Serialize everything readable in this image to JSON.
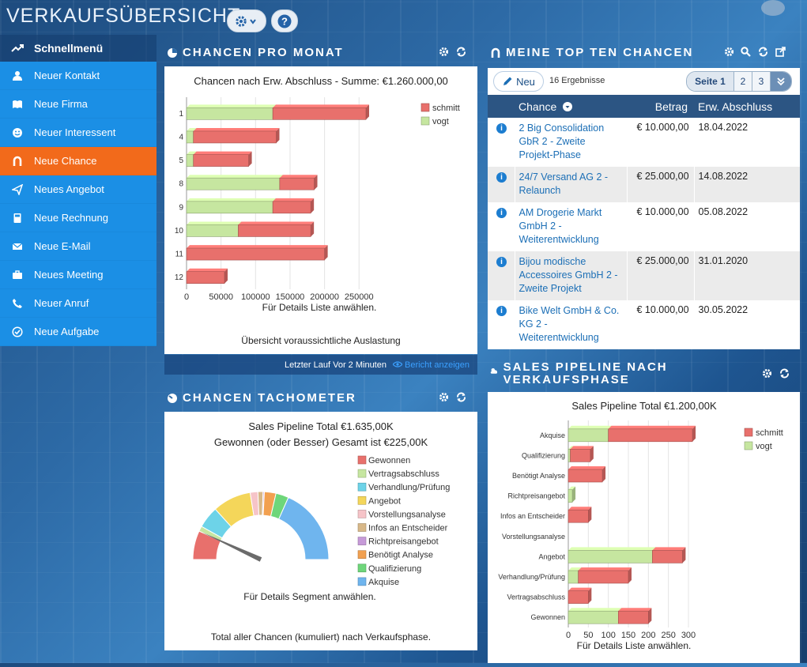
{
  "app": {
    "title": "VERKAUFSÜBERSICHT"
  },
  "sidebar": {
    "header": "Schnellmenü",
    "items": [
      {
        "label": "Neuer Kontakt",
        "icon": "person-icon"
      },
      {
        "label": "Neue Firma",
        "icon": "book-icon"
      },
      {
        "label": "Neuer Interessent",
        "icon": "smiley-icon"
      },
      {
        "label": "Neue Chance",
        "icon": "magnet-icon",
        "active": true
      },
      {
        "label": "Neues Angebot",
        "icon": "paper-plane-icon"
      },
      {
        "label": "Neue Rechnung",
        "icon": "calculator-icon"
      },
      {
        "label": "Neue E-Mail",
        "icon": "envelope-icon"
      },
      {
        "label": "Neues Meeting",
        "icon": "briefcase-icon"
      },
      {
        "label": "Neuer Anruf",
        "icon": "phone-icon"
      },
      {
        "label": "Neue Aufgabe",
        "icon": "check-circle-icon"
      }
    ]
  },
  "panels": {
    "chancen_pro_monat": {
      "title": "CHANCEN PRO MONAT",
      "footer": "Übersicht voraussichtliche Auslastung",
      "last_run": "Letzter Lauf Vor 2 Minuten",
      "report_link": "Bericht anzeigen"
    },
    "top_ten": {
      "title": "MEINE TOP TEN CHANCEN",
      "new_label": "Neu",
      "count": "16 Ergebnisse",
      "pager": {
        "current": "Seite 1",
        "p2": "2",
        "p3": "3"
      },
      "columns": {
        "chance": "Chance",
        "betrag": "Betrag",
        "abschluss": "Erw. Abschluss"
      },
      "rows": [
        {
          "name": "2 Big Consolidation GbR 2 - Zweite Projekt-Phase",
          "betrag": "€ 10.000,00",
          "datum": "18.04.2022"
        },
        {
          "name": "24/7 Versand AG 2 - Relaunch",
          "betrag": "€ 25.000,00",
          "datum": "14.08.2022"
        },
        {
          "name": "AM Drogerie Markt GmbH 2 - Weiterentwicklung",
          "betrag": "€ 10.000,00",
          "datum": "05.08.2022"
        },
        {
          "name": "Bijou modische Accessoires GmbH 2 - Zweite Projekt",
          "betrag": "€ 25.000,00",
          "datum": "31.01.2020"
        },
        {
          "name": "Bike Welt GmbH & Co. KG 2 - Weiterentwicklung",
          "betrag": "€ 10.000,00",
          "datum": "30.05.2022"
        }
      ]
    },
    "tachometer": {
      "title": "CHANCEN TACHOMETER",
      "footer": "Total aller Chancen (kumuliert) nach Verkaufsphase."
    },
    "sales_pipeline": {
      "title": "SALES PIPELINE NACH VERKAUFSPHASE"
    }
  },
  "colors": {
    "schmitt": "#e8706c",
    "vogt": "#c6e6a0",
    "sidebar": "#1b8fe5",
    "active": "#f26a1b",
    "table_header": "#2c5583"
  },
  "chart_data": [
    {
      "id": "chancen_pro_monat",
      "type": "bar",
      "orientation": "horizontal",
      "stacked": true,
      "title": "Chancen nach Erw. Abschluss - Summe: €1.260.000,00",
      "xlabel": "Für Details Liste anwählen.",
      "categories": [
        "1",
        "4",
        "5",
        "8",
        "9",
        "10",
        "11",
        "12"
      ],
      "series": [
        {
          "name": "vogt",
          "values": [
            125000,
            10000,
            10000,
            135000,
            125000,
            75000,
            0,
            0
          ]
        },
        {
          "name": "schmitt",
          "values": [
            135000,
            120000,
            80000,
            50000,
            55000,
            105000,
            200000,
            55000
          ]
        }
      ],
      "xticks": [
        "0",
        "50000",
        "100000",
        "150000",
        "200000",
        "250000"
      ],
      "xlim": [
        0,
        260000
      ],
      "legend": "top-right"
    },
    {
      "id": "tachometer",
      "type": "gauge",
      "title": "Sales Pipeline Total €1.635,00K",
      "subtitle": "Gewonnen (oder Besser) Gesamt ist €225,00K",
      "note": "Für Details Segment anwählen.",
      "needle_value": 225,
      "total": 1635,
      "segments": [
        {
          "name": "Gewonnen",
          "value": 225,
          "color": "#e8706c"
        },
        {
          "name": "Vertragsabschluss",
          "value": 40,
          "color": "#c6e6a0"
        },
        {
          "name": "Verhandlung/Prüfung",
          "value": 170,
          "color": "#6dd3e8"
        },
        {
          "name": "Angebot",
          "value": 300,
          "color": "#f4d65a"
        },
        {
          "name": "Vorstellungsanalyse",
          "value": 60,
          "color": "#f6c4c8"
        },
        {
          "name": "Infos an Entscheider",
          "value": 40,
          "color": "#d8b888"
        },
        {
          "name": "Richtpreisangebot",
          "value": 10,
          "color": "#c69ad8"
        },
        {
          "name": "Benötigt Analyse",
          "value": 90,
          "color": "#f2a050"
        },
        {
          "name": "Qualifizierung",
          "value": 100,
          "color": "#6ed67a"
        },
        {
          "name": "Akquise",
          "value": 600,
          "color": "#6fb5ee"
        }
      ],
      "legend": "right"
    },
    {
      "id": "sales_pipeline",
      "type": "bar",
      "orientation": "horizontal",
      "stacked": true,
      "title": "Sales Pipeline Total €1.200,00K",
      "xlabel": "Für Details Liste anwählen.",
      "categories": [
        "Akquise",
        "Qualifizierung",
        "Benötigt Analyse",
        "Richtpreisangebot",
        "Infos an Entscheider",
        "Vorstellungsanalyse",
        "Angebot",
        "Verhandlung/Prüfung",
        "Vertragsabschluss",
        "Gewonnen"
      ],
      "series": [
        {
          "name": "vogt",
          "values": [
            100,
            5,
            0,
            10,
            0,
            0,
            210,
            25,
            0,
            125
          ]
        },
        {
          "name": "schmitt",
          "values": [
            210,
            50,
            85,
            0,
            50,
            0,
            75,
            125,
            50,
            75
          ]
        }
      ],
      "xticks": [
        "0",
        "50",
        "100",
        "150",
        "200",
        "250",
        "300"
      ],
      "xlim": [
        0,
        300
      ],
      "legend": "top-right"
    }
  ]
}
